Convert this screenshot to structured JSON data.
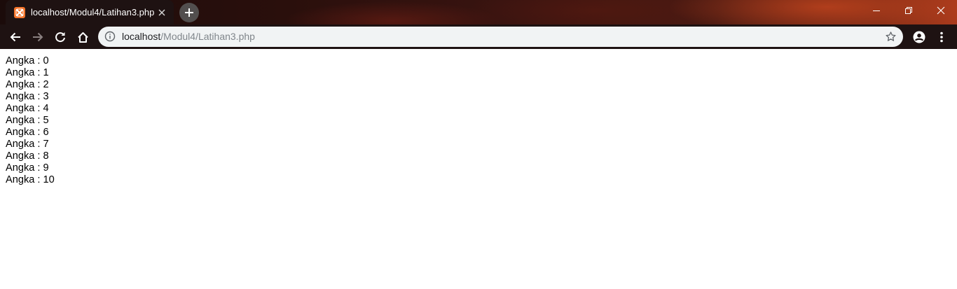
{
  "browser": {
    "tab": {
      "title": "localhost/Modul4/Latihan3.php",
      "favicon": "xampp-icon"
    },
    "new_tab_icon": "plus-icon",
    "window_controls": [
      "minimize-icon",
      "restore-icon",
      "close-icon"
    ],
    "toolbar": {
      "back_icon": "arrow-left-icon",
      "forward_icon": "arrow-right-icon",
      "reload_icon": "reload-icon",
      "home_icon": "home-icon",
      "profile_icon": "account-circle-icon",
      "menu_icon": "kebab-menu-icon"
    },
    "address_bar": {
      "host": "localhost",
      "path": "/Modul4/Latihan3.php",
      "info_icon": "info-icon",
      "bookmark_icon": "star-outline-icon"
    },
    "colors": {
      "tab_background": "#1e1212",
      "omnibox_background": "#f1f3f4",
      "favicon": "#f4732a"
    }
  },
  "page": {
    "lines": [
      "Angka : 0",
      "Angka : 1",
      "Angka : 2",
      "Angka : 3",
      "Angka : 4",
      "Angka : 5",
      "Angka : 6",
      "Angka : 7",
      "Angka : 8",
      "Angka : 9",
      "Angka : 10"
    ]
  }
}
